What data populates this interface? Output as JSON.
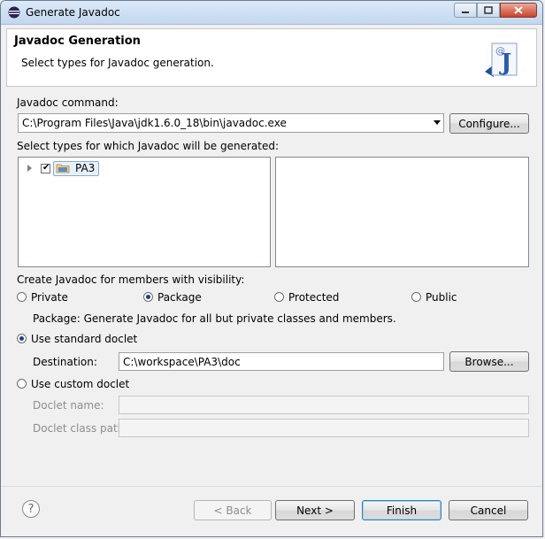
{
  "window": {
    "title": "Generate Javadoc"
  },
  "banner": {
    "heading": "Javadoc Generation",
    "description": "Select types for Javadoc generation."
  },
  "command": {
    "label": "Javadoc command:",
    "value": "C:\\Program Files\\Java\\jdk1.6.0_18\\bin\\javadoc.exe",
    "configure_label": "Configure..."
  },
  "types": {
    "label": "Select types for which Javadoc will be generated:",
    "tree": [
      {
        "label": "PA3",
        "checked": true
      }
    ]
  },
  "visibility": {
    "label": "Create Javadoc for members with visibility:",
    "options": [
      "Private",
      "Package",
      "Protected",
      "Public"
    ],
    "selected": "Package",
    "description": "Package: Generate Javadoc for all but private classes and members."
  },
  "standard_doclet": {
    "label": "Use standard doclet",
    "destination_label": "Destination:",
    "destination_value": "C:\\workspace\\PA3\\doc",
    "browse_label": "Browse..."
  },
  "custom_doclet": {
    "label": "Use custom doclet",
    "name_label": "Doclet name:",
    "class_path_label": "Doclet class path:"
  },
  "footer": {
    "help": "?",
    "back_label": "< Back",
    "next_label": "Next >",
    "finish_label": "Finish",
    "cancel_label": "Cancel"
  }
}
